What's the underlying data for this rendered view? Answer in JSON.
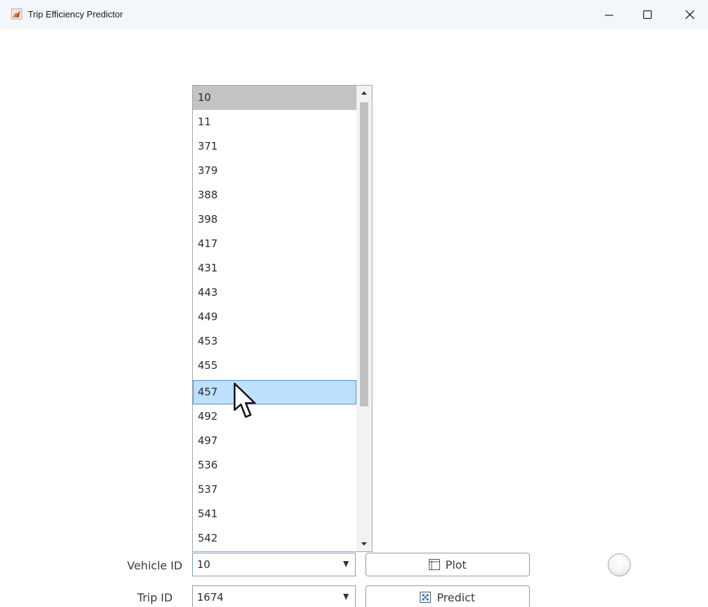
{
  "window": {
    "title": "Trip Efficiency Predictor",
    "controls": {
      "minimize_icon": "minimize-icon",
      "maximize_icon": "maximize-icon",
      "close_icon": "close-icon"
    }
  },
  "vehicle_dropdown": {
    "items": [
      "10",
      "11",
      "371",
      "379",
      "388",
      "398",
      "417",
      "431",
      "443",
      "449",
      "453",
      "455",
      "457",
      "492",
      "497",
      "536",
      "537",
      "541",
      "542"
    ],
    "selected_item": "10",
    "hovered_item": "457"
  },
  "form": {
    "vehicle_label": "Vehicle ID",
    "vehicle_value": "10",
    "trip_label": "Trip ID",
    "trip_value": "1674",
    "plot_button_label": "Plot",
    "predict_button_label": "Predict"
  },
  "colors": {
    "selected_item_bg": "#c3c3c3",
    "hover_item_bg": "#bde0ff",
    "hover_item_border": "#4a90d9",
    "titlebar_bg": "#f3f6fb"
  }
}
